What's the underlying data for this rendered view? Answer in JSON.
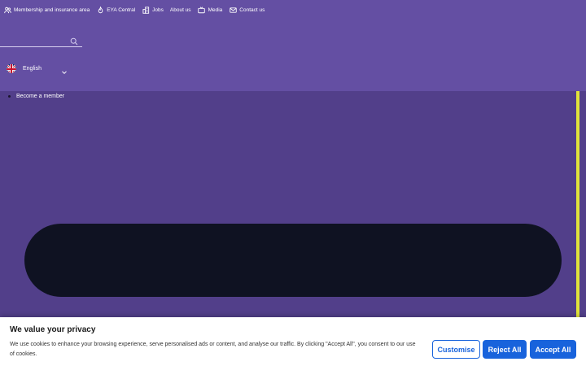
{
  "topnav": {
    "items": [
      {
        "label": "Membership and insurance area",
        "icon": "users-icon"
      },
      {
        "label": "EYA Central",
        "icon": "flame-icon"
      },
      {
        "label": "Jobs",
        "icon": "building-icon"
      },
      {
        "label": "About us",
        "icon": ""
      },
      {
        "label": "Media",
        "icon": "tv-icon"
      },
      {
        "label": "Contact us",
        "icon": "mail-icon"
      }
    ]
  },
  "search": {
    "placeholder": "",
    "value": ""
  },
  "language": {
    "label": "English",
    "flag": "uk-flag-icon"
  },
  "secondary_nav": {
    "member_label": "Become a member"
  },
  "cookie": {
    "title": "We value your privacy",
    "text": "We use cookies to enhance your browsing experience, serve personalised ads or content, and analyse our traffic. By clicking \"Accept All\", you consent to our use of cookies.",
    "customise_label": "Customise",
    "reject_label": "Reject All",
    "accept_label": "Accept All"
  },
  "colors": {
    "header_bg": "#644fa3",
    "page_bg": "#523f8a",
    "hero_bg": "#0f1222",
    "accent": "#e1e33a",
    "button_blue": "#1863dc"
  }
}
